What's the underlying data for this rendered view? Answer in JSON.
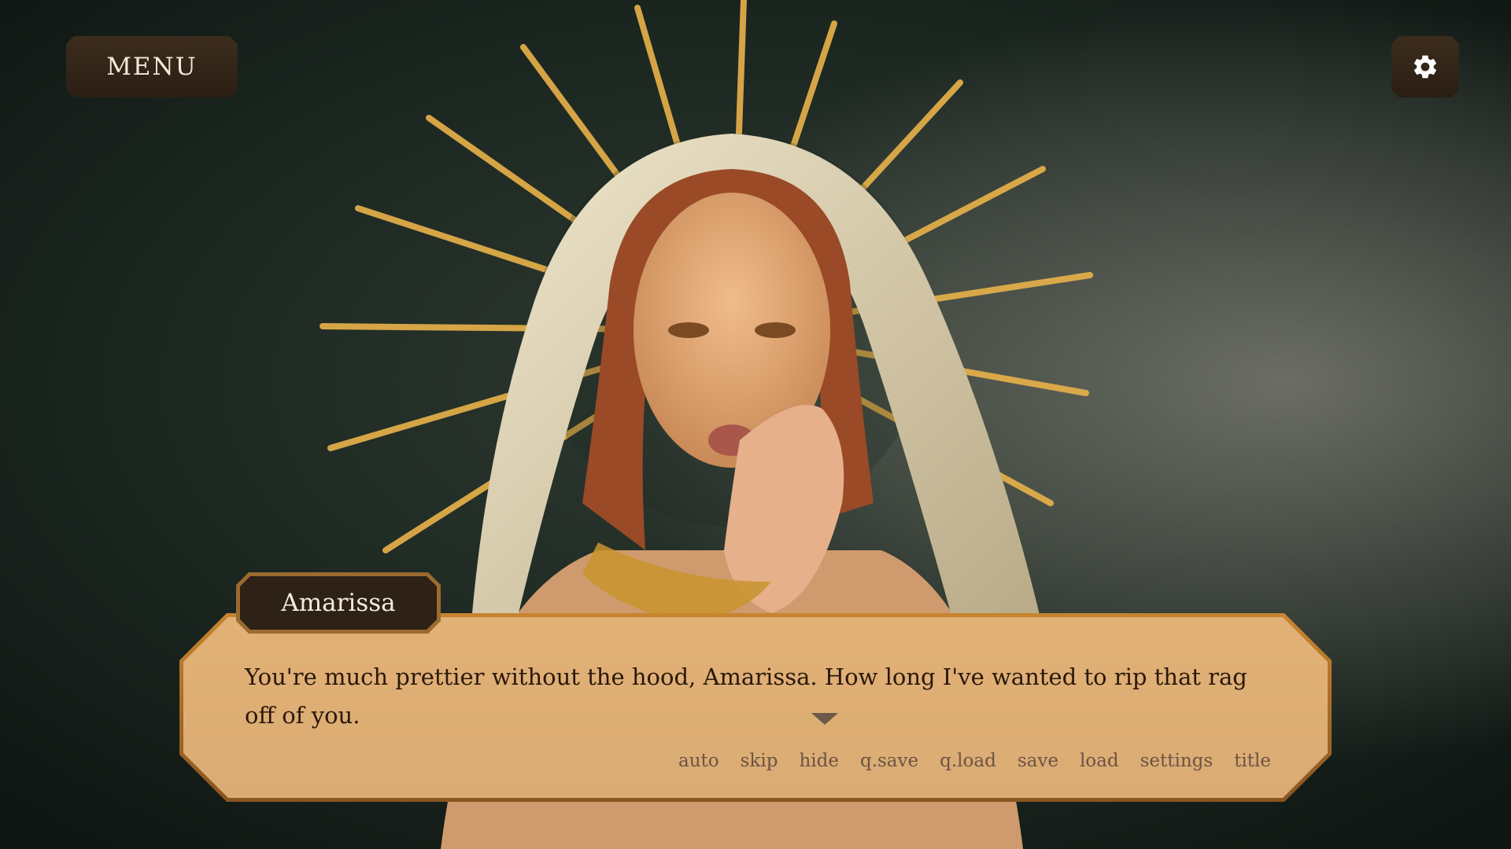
{
  "menu_button": {
    "label": "MENU"
  },
  "settings_button": {
    "icon": "gear-icon"
  },
  "speaker": {
    "name": "Amarissa"
  },
  "dialogue": {
    "text": "You're much prettier without the hood, Amarissa. How long I've wanted to rip that rag off of you."
  },
  "quick_menu": {
    "auto": "auto",
    "skip": "skip",
    "hide": "hide",
    "qsave": "q.save",
    "qload": "q.load",
    "save": "save",
    "load": "load",
    "settings": "settings",
    "title": "title"
  },
  "colors": {
    "button_bg": "#2e2116",
    "dialog_bg": "#e5b780",
    "frame": "#c8842f",
    "dialog_text": "#2a180c",
    "quick_menu_text": "#6b5444"
  }
}
